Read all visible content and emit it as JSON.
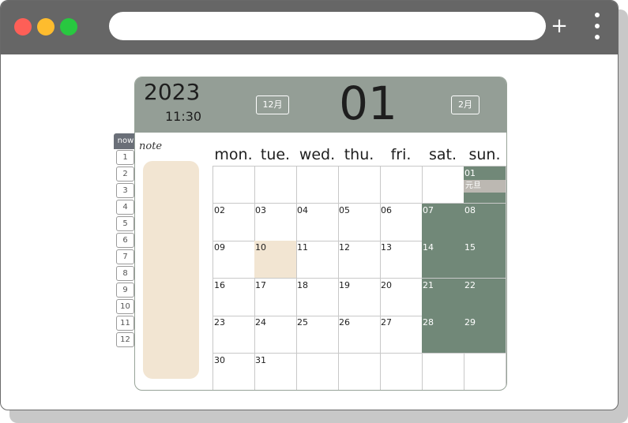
{
  "browser": {
    "new_tab_label": "+"
  },
  "calendar": {
    "year": "2023",
    "time": "11:30",
    "month": "01",
    "prev_month_label": "12月",
    "next_month_label": "2月",
    "note_label": "note",
    "now_label": "now",
    "weekdays": [
      "mon.",
      "tue.",
      "wed.",
      "thu.",
      "fri.",
      "sat.",
      "sun."
    ],
    "month_tabs": [
      "1",
      "2",
      "3",
      "4",
      "5",
      "6",
      "7",
      "8",
      "9",
      "10",
      "11",
      "12"
    ],
    "weeks": [
      [
        "",
        "",
        "",
        "",
        "",
        "",
        "01"
      ],
      [
        "02",
        "03",
        "04",
        "05",
        "06",
        "07",
        "08"
      ],
      [
        "09",
        "10",
        "11",
        "12",
        "13",
        "14",
        "15"
      ],
      [
        "16",
        "17",
        "18",
        "19",
        "20",
        "21",
        "22"
      ],
      [
        "23",
        "24",
        "25",
        "26",
        "27",
        "28",
        "29"
      ],
      [
        "30",
        "31",
        "",
        "",
        "",
        "",
        ""
      ]
    ],
    "today": "10",
    "holiday": {
      "date": "01",
      "label": "元旦"
    },
    "colors": {
      "header_bg": "#949e96",
      "weekend_bg": "#718878",
      "today_bg": "#f2e5d2",
      "note_bg": "#f2e5d2"
    }
  }
}
